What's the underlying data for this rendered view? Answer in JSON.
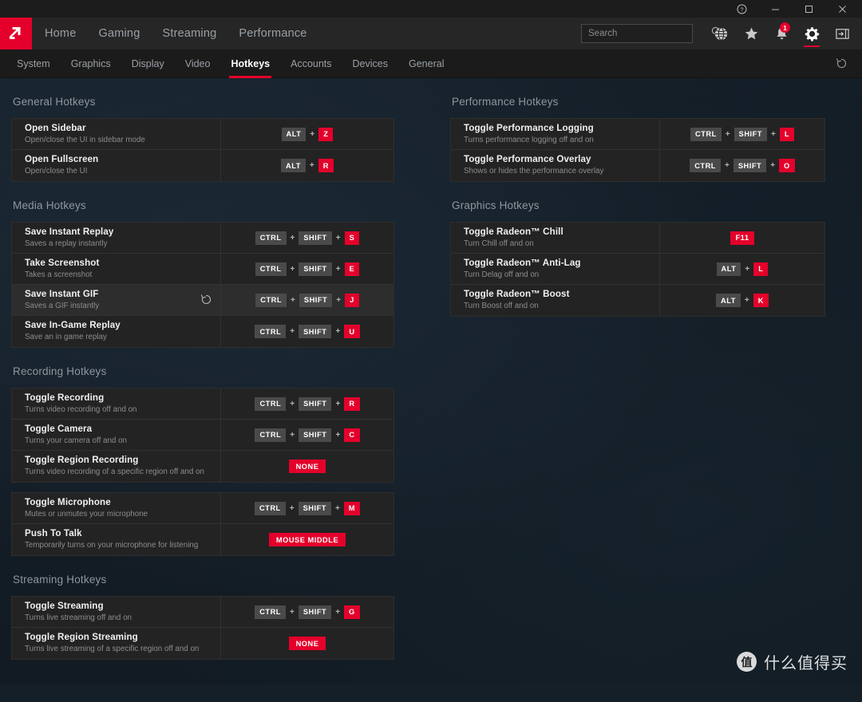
{
  "window": {
    "controls": [
      {
        "name": "help",
        "glyph": "?"
      },
      {
        "name": "minimize",
        "glyph": "—"
      },
      {
        "name": "maximize",
        "glyph": "□"
      },
      {
        "name": "close",
        "glyph": "✕"
      }
    ]
  },
  "nav": {
    "logo": "amd-logo",
    "links": [
      {
        "label": "Home",
        "active": false
      },
      {
        "label": "Gaming",
        "active": false
      },
      {
        "label": "Streaming",
        "active": false
      },
      {
        "label": "Performance",
        "active": false
      }
    ],
    "search": {
      "value": "",
      "placeholder": "Search"
    },
    "icons": [
      {
        "name": "globe-icon",
        "active": false,
        "badge": null
      },
      {
        "name": "star-icon",
        "active": false,
        "badge": null
      },
      {
        "name": "bell-icon",
        "active": false,
        "badge": "1"
      },
      {
        "name": "gear-icon",
        "active": true,
        "badge": null
      },
      {
        "name": "sidebar-toggle-icon",
        "active": false,
        "badge": null
      }
    ]
  },
  "subnav": {
    "items": [
      {
        "label": "System",
        "active": false
      },
      {
        "label": "Graphics",
        "active": false
      },
      {
        "label": "Display",
        "active": false
      },
      {
        "label": "Video",
        "active": false
      },
      {
        "label": "Hotkeys",
        "active": true
      },
      {
        "label": "Accounts",
        "active": false
      },
      {
        "label": "Devices",
        "active": false
      },
      {
        "label": "General",
        "active": false
      }
    ],
    "reset_icon": "reset-icon"
  },
  "colors": {
    "accent": "#e4002b",
    "modifier_key": "#4a4a4a",
    "background": "#151f28",
    "card": "#232323"
  },
  "left_column": [
    {
      "title": "General Hotkeys",
      "groups": [
        {
          "rows": [
            {
              "name": "Open Sidebar",
              "description": "Open/close the UI in sidebar mode",
              "keys": [
                {
                  "label": "ALT",
                  "type": "mod"
                },
                {
                  "label": "Z",
                  "type": "act"
                }
              ],
              "hover": false,
              "reset": false
            },
            {
              "name": "Open Fullscreen",
              "description": "Open/close the UI",
              "keys": [
                {
                  "label": "ALT",
                  "type": "mod"
                },
                {
                  "label": "R",
                  "type": "act"
                }
              ],
              "hover": false,
              "reset": false
            }
          ]
        }
      ]
    },
    {
      "title": "Media Hotkeys",
      "groups": [
        {
          "rows": [
            {
              "name": "Save Instant Replay",
              "description": "Saves a replay instantly",
              "keys": [
                {
                  "label": "CTRL",
                  "type": "mod"
                },
                {
                  "label": "SHIFT",
                  "type": "mod"
                },
                {
                  "label": "S",
                  "type": "act"
                }
              ],
              "hover": false,
              "reset": false
            },
            {
              "name": "Take Screenshot",
              "description": "Takes a screenshot",
              "keys": [
                {
                  "label": "CTRL",
                  "type": "mod"
                },
                {
                  "label": "SHIFT",
                  "type": "mod"
                },
                {
                  "label": "E",
                  "type": "act"
                }
              ],
              "hover": false,
              "reset": false
            },
            {
              "name": "Save Instant GIF",
              "description": "Saves a GIF instantly",
              "keys": [
                {
                  "label": "CTRL",
                  "type": "mod"
                },
                {
                  "label": "SHIFT",
                  "type": "mod"
                },
                {
                  "label": "J",
                  "type": "act"
                }
              ],
              "hover": true,
              "reset": true
            },
            {
              "name": "Save In-Game Replay",
              "description": "Save an in game replay",
              "keys": [
                {
                  "label": "CTRL",
                  "type": "mod"
                },
                {
                  "label": "SHIFT",
                  "type": "mod"
                },
                {
                  "label": "U",
                  "type": "act"
                }
              ],
              "hover": false,
              "reset": false
            }
          ]
        }
      ]
    },
    {
      "title": "Recording Hotkeys",
      "groups": [
        {
          "rows": [
            {
              "name": "Toggle Recording",
              "description": "Turns video recording off and on",
              "keys": [
                {
                  "label": "CTRL",
                  "type": "mod"
                },
                {
                  "label": "SHIFT",
                  "type": "mod"
                },
                {
                  "label": "R",
                  "type": "act"
                }
              ],
              "hover": false,
              "reset": false
            },
            {
              "name": "Toggle Camera",
              "description": "Turns your camera off and on",
              "keys": [
                {
                  "label": "CTRL",
                  "type": "mod"
                },
                {
                  "label": "SHIFT",
                  "type": "mod"
                },
                {
                  "label": "C",
                  "type": "act"
                }
              ],
              "hover": false,
              "reset": false
            },
            {
              "name": "Toggle Region Recording",
              "description": "Turns video recording of a specific region off and on",
              "keys": [
                {
                  "label": "NONE",
                  "type": "act",
                  "wide": true
                }
              ],
              "hover": false,
              "reset": false
            }
          ]
        },
        {
          "rows": [
            {
              "name": "Toggle Microphone",
              "description": "Mutes or unmutes your microphone",
              "keys": [
                {
                  "label": "CTRL",
                  "type": "mod"
                },
                {
                  "label": "SHIFT",
                  "type": "mod"
                },
                {
                  "label": "M",
                  "type": "act"
                }
              ],
              "hover": false,
              "reset": false
            },
            {
              "name": "Push To Talk",
              "description": "Temporarily turns on your microphone for listening",
              "keys": [
                {
                  "label": "MOUSE MIDDLE",
                  "type": "act",
                  "wide": true
                }
              ],
              "hover": false,
              "reset": false
            }
          ]
        }
      ]
    },
    {
      "title": "Streaming Hotkeys",
      "groups": [
        {
          "rows": [
            {
              "name": "Toggle Streaming",
              "description": "Turns live streaming off and on",
              "keys": [
                {
                  "label": "CTRL",
                  "type": "mod"
                },
                {
                  "label": "SHIFT",
                  "type": "mod"
                },
                {
                  "label": "G",
                  "type": "act"
                }
              ],
              "hover": false,
              "reset": false
            },
            {
              "name": "Toggle Region Streaming",
              "description": "Turns live streaming of a specific region off and on",
              "keys": [
                {
                  "label": "NONE",
                  "type": "act",
                  "wide": true
                }
              ],
              "hover": false,
              "reset": false
            }
          ]
        }
      ]
    }
  ],
  "right_column": [
    {
      "title": "Performance Hotkeys",
      "groups": [
        {
          "rows": [
            {
              "name": "Toggle Performance Logging",
              "description": "Turns performance logging off and on",
              "keys": [
                {
                  "label": "CTRL",
                  "type": "mod"
                },
                {
                  "label": "SHIFT",
                  "type": "mod"
                },
                {
                  "label": "L",
                  "type": "act"
                }
              ],
              "hover": false,
              "reset": false
            },
            {
              "name": "Toggle Performance Overlay",
              "description": "Shows or hides the performance overlay",
              "keys": [
                {
                  "label": "CTRL",
                  "type": "mod"
                },
                {
                  "label": "SHIFT",
                  "type": "mod"
                },
                {
                  "label": "O",
                  "type": "act"
                }
              ],
              "hover": false,
              "reset": false
            }
          ]
        }
      ]
    },
    {
      "title": "Graphics Hotkeys",
      "groups": [
        {
          "rows": [
            {
              "name": "Toggle Radeon™ Chill",
              "description": "Turn Chill off and on",
              "keys": [
                {
                  "label": "F11",
                  "type": "act"
                }
              ],
              "hover": false,
              "reset": false
            },
            {
              "name": "Toggle Radeon™ Anti-Lag",
              "description": "Turn Delag off and on",
              "keys": [
                {
                  "label": "ALT",
                  "type": "mod"
                },
                {
                  "label": "L",
                  "type": "act"
                }
              ],
              "hover": false,
              "reset": false
            },
            {
              "name": "Toggle Radeon™ Boost",
              "description": "Turn Boost off and on",
              "keys": [
                {
                  "label": "ALT",
                  "type": "mod"
                },
                {
                  "label": "K",
                  "type": "act"
                }
              ],
              "hover": false,
              "reset": false
            }
          ]
        }
      ]
    }
  ],
  "watermark": {
    "logo_char": "值",
    "text": "什么值得买"
  }
}
